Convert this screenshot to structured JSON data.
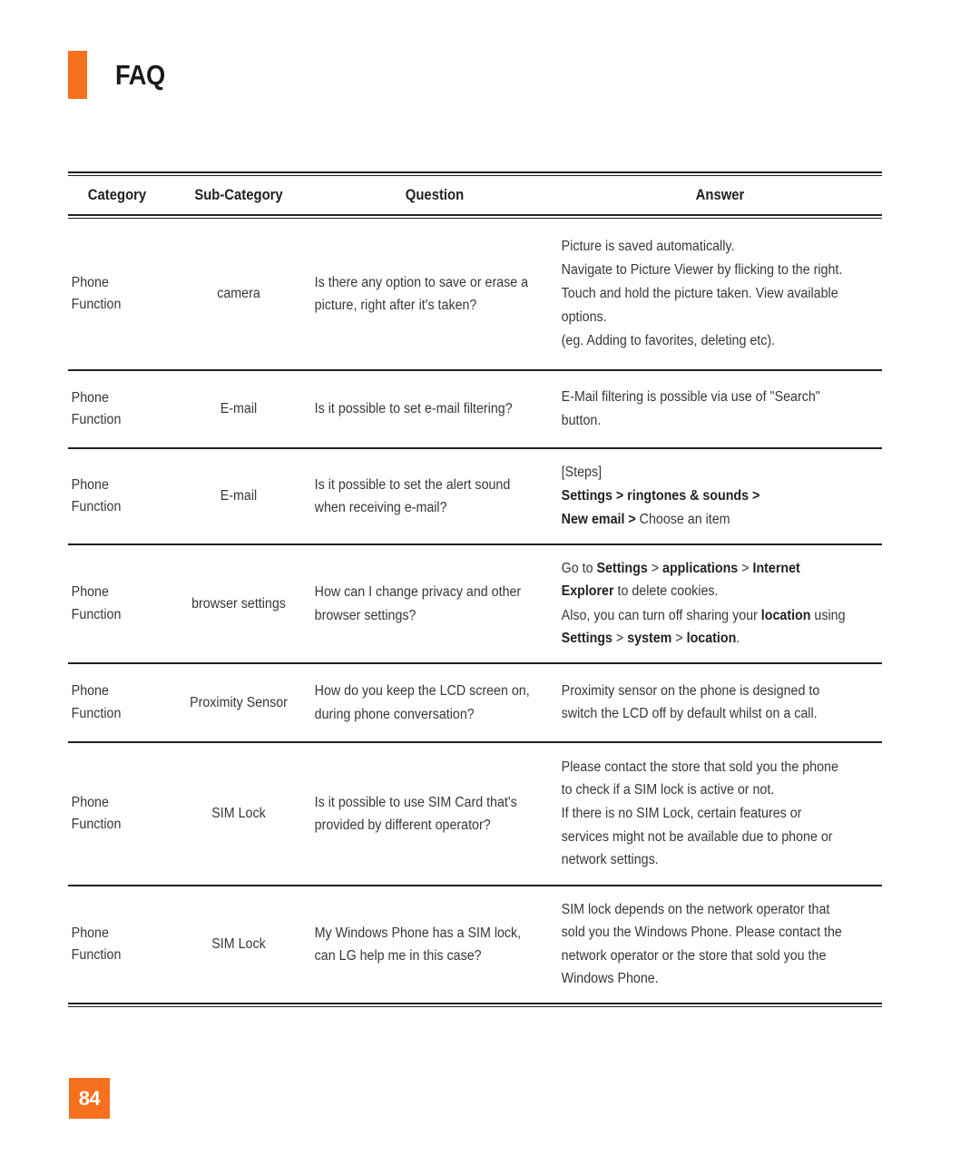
{
  "document": {
    "title": "FAQ",
    "page_number": "84",
    "accent_color": "#f7701d",
    "text_color": "#231f20"
  },
  "table": {
    "columns": [
      "Category",
      "Sub-Category",
      "Question",
      "Answer"
    ],
    "rows": [
      {
        "category": "Phone\nFunction",
        "sub_category": "camera",
        "question": "Is there any option to save or erase a picture, right after it's taken?",
        "answer_paragraphs": [
          "Picture is saved automatically.",
          "Navigate to Picture Viewer by flicking to the right.",
          "Touch and hold the picture taken. View available options.",
          "(eg. Adding to favorites, deleting etc)."
        ]
      },
      {
        "category": "Phone\nFunction",
        "sub_category": "E-mail",
        "question": "Is it possible to set e-mail filtering?",
        "answer_paragraphs": [
          "E-Mail filtering is possible via use of \"Search\" button."
        ]
      },
      {
        "category": "Phone\nFunction",
        "sub_category": "E-mail",
        "question": "Is it possible to set the alert sound when receiving e-mail?",
        "answer_paragraphs": [
          "[Steps]"
        ],
        "answer_rich": [
          {
            "text": "[Steps]",
            "bold": false
          },
          {
            "text": "Settings > ringtones & sounds >",
            "bold": true
          },
          {
            "text": "New email >",
            "bold": true,
            "suffix": " Choose an item"
          }
        ]
      },
      {
        "category": "Phone\nFunction",
        "sub_category": "browser settings",
        "question": "How can I change privacy and other browser settings?",
        "answer_paragraphs": [
          "Go to Settings > applications > Internet Explorer to delete cookies.",
          "Also, you can turn off sharing your location using Settings > system > location."
        ]
      },
      {
        "category": "Phone\nFunction",
        "sub_category": "Proximity Sensor",
        "question": "How do you keep the LCD screen on, during phone conversation?",
        "answer_paragraphs": [
          "Proximity sensor on the phone is designed to switch the LCD off by default whilst on a call."
        ]
      },
      {
        "category": "Phone\nFunction",
        "sub_category": "SIM Lock",
        "question": "Is it possible to use SIM Card that's provided by different operator?",
        "answer_paragraphs": [
          "Please contact the store that sold you the phone to check if a SIM lock is active or not.",
          "If there is no SIM Lock, certain features or services might not be available due to phone or network settings."
        ]
      },
      {
        "category": "Phone\nFunction",
        "sub_category": "SIM Lock",
        "question": "My Windows Phone has a SIM lock, can LG help me in this case?",
        "answer_paragraphs": [
          "SIM lock depends on the network operator that sold you the Windows Phone.  Please contact the network operator or the store that sold you the Windows Phone."
        ]
      }
    ]
  }
}
